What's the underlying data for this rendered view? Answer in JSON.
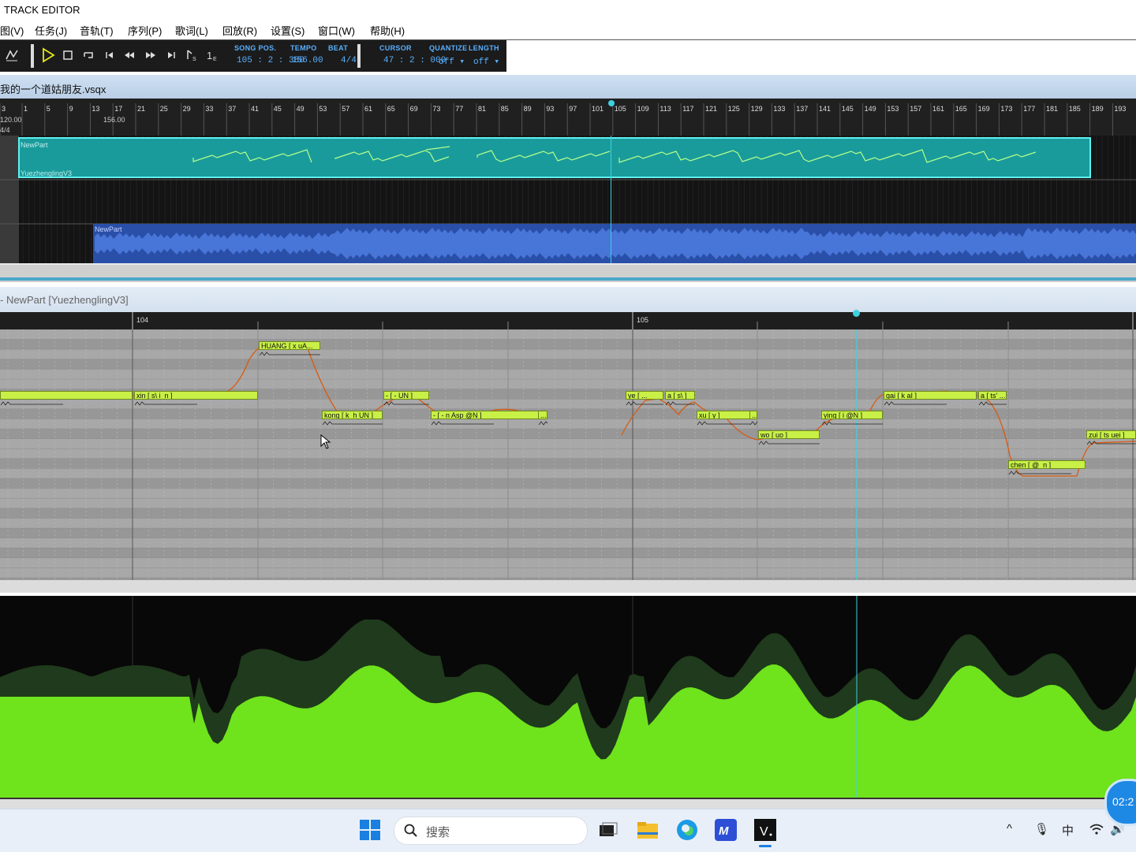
{
  "window": {
    "title": "TRACK EDITOR"
  },
  "menu": [
    "图(V)",
    "任务(J)",
    "音轨(T)",
    "序列(P)",
    "歌词(L)",
    "回放(R)",
    "设置(S)",
    "窗口(W)",
    "帮助(H)"
  ],
  "toolbar": {
    "song_pos_label": "SONG POS.",
    "song_pos_value": "105 : 2 : 380",
    "tempo_label": "TEMPO",
    "tempo_value": "156.00",
    "beat_label": "BEAT",
    "beat_value": "4/4",
    "cursor_label": "CURSOR",
    "cursor_value": "47 : 2 : 000",
    "quantize_label": "QUANTIZE",
    "quantize_value": "off",
    "length_label": "LENGTH",
    "length_value": "off",
    "icons": [
      "mode-icon",
      "play-icon",
      "stop-icon",
      "loop-icon",
      "goto-start-icon",
      "rewind-icon",
      "fast-forward-icon",
      "goto-end-icon",
      "snap-start-icon",
      "snap-end-icon"
    ]
  },
  "arrangement": {
    "file_name": "我的一个道姑朋友.vsqx",
    "ruler_marks": [
      "3",
      "1",
      "5",
      "9",
      "13",
      "17",
      "21",
      "25",
      "29",
      "33",
      "37",
      "41",
      "45",
      "49",
      "53",
      "57",
      "61",
      "65",
      "69",
      "73",
      "77",
      "81",
      "85",
      "89",
      "93",
      "97",
      "101",
      "105",
      "109",
      "113",
      "117",
      "121",
      "125",
      "129",
      "133",
      "137",
      "141",
      "145",
      "149",
      "153",
      "157",
      "161",
      "165",
      "169",
      "173",
      "177",
      "181",
      "185",
      "189",
      "193"
    ],
    "tempo_marks": [
      "120.00",
      "156.00"
    ],
    "beat_mark": "4/4",
    "vocal_part": {
      "name": "NewPart",
      "singer": "YuezhenglingV3",
      "color": "#1a9b9b"
    },
    "audio_part": {
      "name": "NewPart",
      "color": "#2a4fa8"
    }
  },
  "piano_roll": {
    "title": "- NewPart [YuezhenglingV3]",
    "bar_labels": [
      "104",
      "105"
    ],
    "notes": [
      {
        "lyric": "",
        "color": "#c8f046"
      },
      {
        "lyric": "xin [ s\\ i_n ]"
      },
      {
        "lyric": "HUANG [ x uA..."
      },
      {
        "lyric": "kong [ k_h UN ]"
      },
      {
        "lyric": "- [ - UN ]"
      },
      {
        "lyric": "- [ - n Asp @N ]"
      },
      {
        "lyric": "..."
      },
      {
        "lyric": "ye [ ..."
      },
      {
        "lyric": "a [ s\\ ]"
      },
      {
        "lyric": "xu [ y ]"
      },
      {
        "lyric": "..."
      },
      {
        "lyric": "wo [ uo ]"
      },
      {
        "lyric": "ying [ i @N ]"
      },
      {
        "lyric": "gai [ k aI ]"
      },
      {
        "lyric": "a [ ts' ..."
      },
      {
        "lyric": "chen [ @_n ]"
      },
      {
        "lyric": "zui [ ts uei ]"
      }
    ]
  },
  "control": {
    "colors": {
      "fill": "#6fe31c",
      "dark": "#1f3a1c"
    }
  },
  "taskbar": {
    "search_placeholder": "搜索",
    "tray": [
      "^",
      "🎙",
      "中",
      "wifi",
      "🔊"
    ],
    "clock": "02:2"
  }
}
